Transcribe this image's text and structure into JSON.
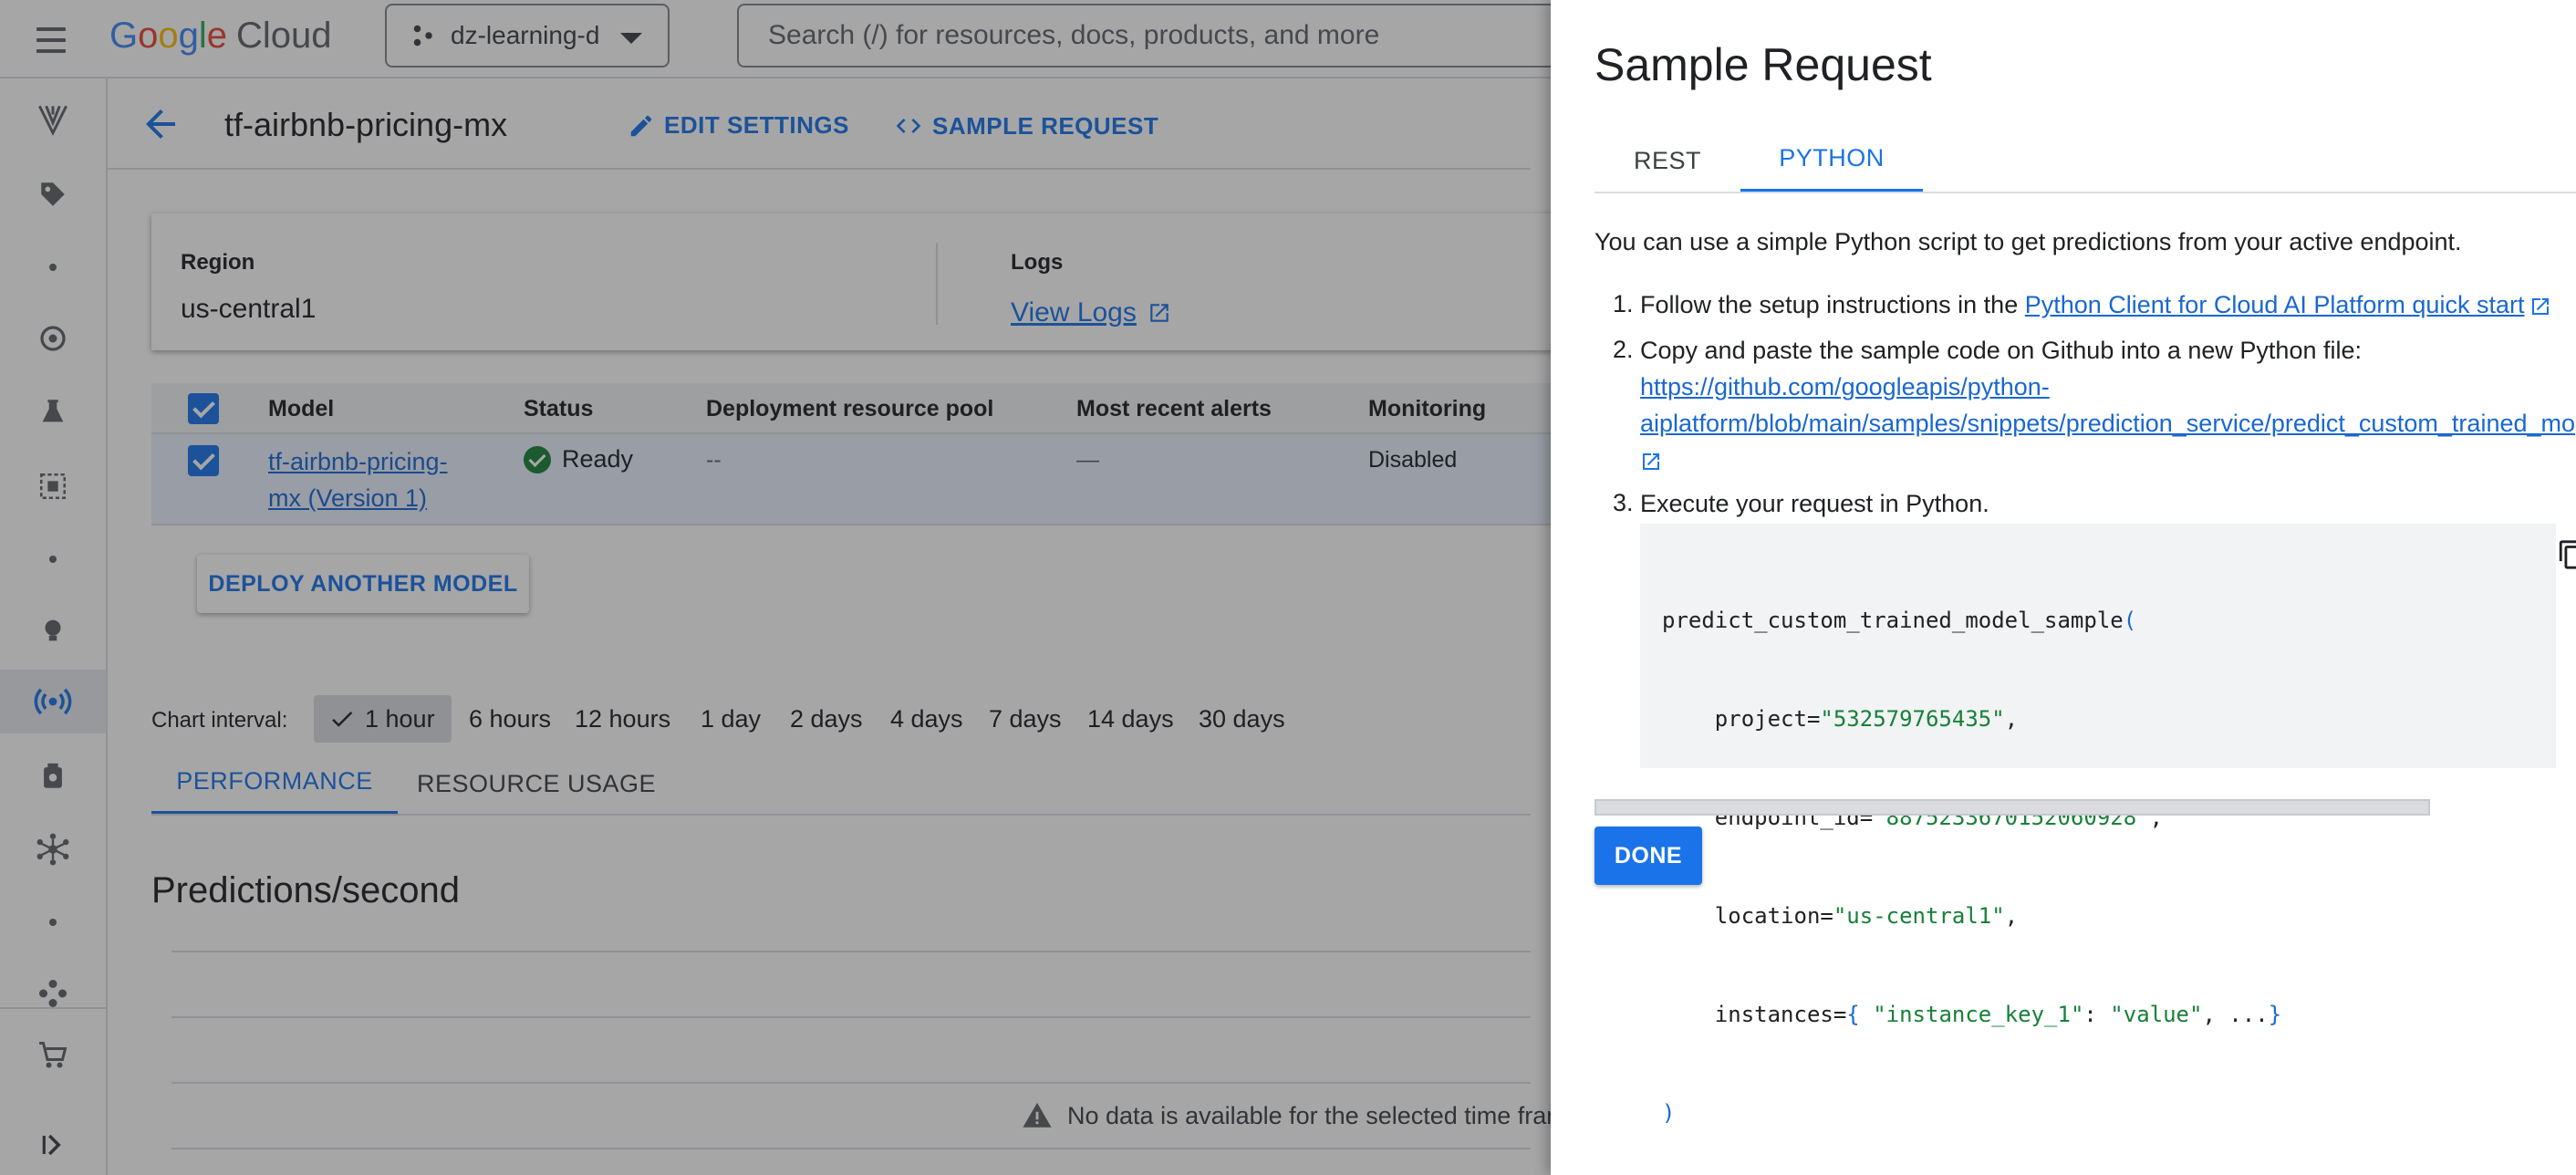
{
  "topbar": {
    "logo": {
      "google": "Google",
      "cloud": "Cloud"
    },
    "project_name": "dz-learning-d",
    "search_placeholder": "Search (/) for resources, docs, products, and more"
  },
  "header": {
    "endpoint_name": "tf-airbnb-pricing-mx",
    "edit_settings": "EDIT SETTINGS",
    "sample_request": "SAMPLE REQUEST"
  },
  "info": {
    "region_label": "Region",
    "region_value": "us-central1",
    "logs_label": "Logs",
    "view_logs": "View Logs"
  },
  "table": {
    "headers": [
      "Model",
      "Status",
      "Deployment resource pool",
      "Most recent alerts",
      "Monitoring"
    ],
    "row": {
      "model_line1": "tf-airbnb-pricing-",
      "model_line2": "mx (Version 1)",
      "status": "Ready",
      "pool": "--",
      "alerts": "—",
      "monitoring": "Disabled"
    }
  },
  "deploy_button": "DEPLOY ANOTHER MODEL",
  "chart_interval": {
    "label": "Chart interval:",
    "options": [
      "1 hour",
      "6 hours",
      "12 hours",
      "1 day",
      "2 days",
      "4 days",
      "7 days",
      "14 days",
      "30 days"
    ],
    "selected": "1 hour"
  },
  "metric_tabs": [
    "PERFORMANCE",
    "RESOURCE USAGE"
  ],
  "predictions_title": "Predictions/second",
  "no_data_text": "No data is available for the selected time fran",
  "panel": {
    "title": "Sample Request",
    "tabs": [
      "REST",
      "PYTHON"
    ],
    "active_tab": "PYTHON",
    "intro": "You can use a simple Python script to get predictions from your active endpoint.",
    "step1_num": "1.",
    "step1_text": "Follow the setup instructions in the ",
    "step1_link": "Python Client for Cloud AI Platform quick start",
    "step2_num": "2.",
    "step2_text": "Copy and paste the sample code on Github into a new Python file:",
    "step2_link_line1": "https://github.com/googleapis/python-",
    "step2_link_line2": "aiplatform/blob/main/samples/snippets/prediction_service/predict_custom_trained_mo",
    "step3_num": "3.",
    "step3_text": "Execute your request in Python.",
    "code": {
      "fn": "predict_custom_trained_model_sample",
      "project_key": "    project=",
      "project_val": "\"532579765435\"",
      "endpoint_key": "    endpoint_id=",
      "endpoint_val": "\"8875233670152060928\"",
      "location_key": "    location=",
      "location_val": "\"us-central1\"",
      "instances_key": "    instances=",
      "instances_k": "\"instance_key_1\"",
      "instances_v": "\"value\""
    },
    "done": "DONE"
  }
}
